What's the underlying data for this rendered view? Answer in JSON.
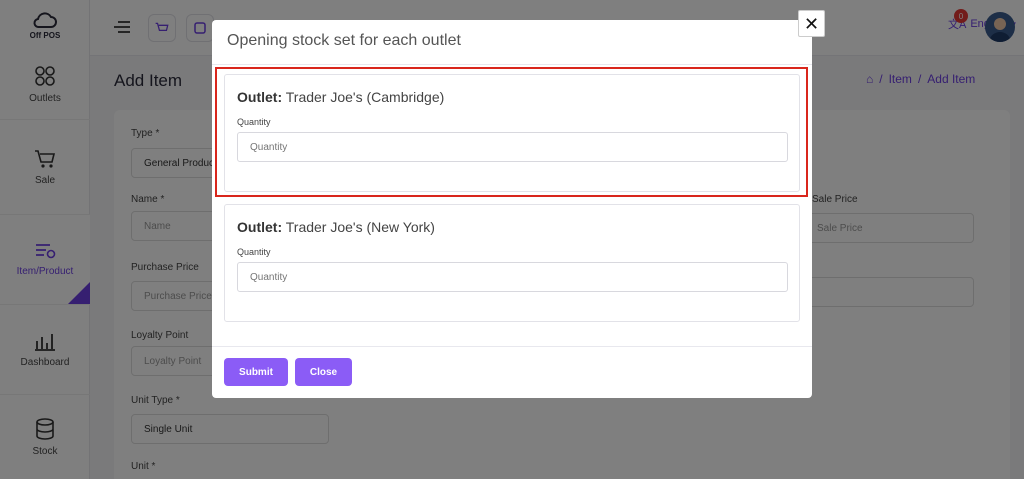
{
  "app": {
    "logo_text": "Off POS"
  },
  "sidebar": {
    "items": [
      {
        "label": "Outlets",
        "icon": "grid-icon"
      },
      {
        "label": "Sale",
        "icon": "cart-icon"
      },
      {
        "label": "Item/Product",
        "icon": "product-icon"
      },
      {
        "label": "Dashboard",
        "icon": "bar-chart-icon"
      },
      {
        "label": "Stock",
        "icon": "database-icon"
      }
    ]
  },
  "header": {
    "language": "English",
    "notification_count": "0"
  },
  "page": {
    "title": "Add Item",
    "breadcrumb": [
      "Item",
      "Add Item"
    ]
  },
  "form": {
    "type_label": "Type *",
    "type_value": "General Product",
    "name_label": "Name *",
    "name_placeholder": "Name",
    "purchase_price_label": "Purchase Price",
    "purchase_price_placeholder": "Purchase Price",
    "loyalty_point_label": "Loyalty Point",
    "loyalty_point_placeholder": "Loyalty Point",
    "unit_type_label": "Unit Type *",
    "unit_type_value": "Single Unit",
    "unit_label": "Unit *",
    "sale_price_label": "Sale Price",
    "sale_price_placeholder": "Sale Price"
  },
  "modal": {
    "title": "Opening stock set for each outlet",
    "outlets": [
      {
        "prefix": "Outlet:",
        "name": "Trader Joe's (Cambridge)",
        "quantity_label": "Quantity",
        "quantity_placeholder": "Quantity"
      },
      {
        "prefix": "Outlet:",
        "name": "Trader Joe's (New York)",
        "quantity_label": "Quantity",
        "quantity_placeholder": "Quantity"
      }
    ],
    "submit_label": "Submit",
    "close_label": "Close"
  },
  "colors": {
    "accent": "#8b5cf6",
    "highlight": "#d9261c"
  }
}
